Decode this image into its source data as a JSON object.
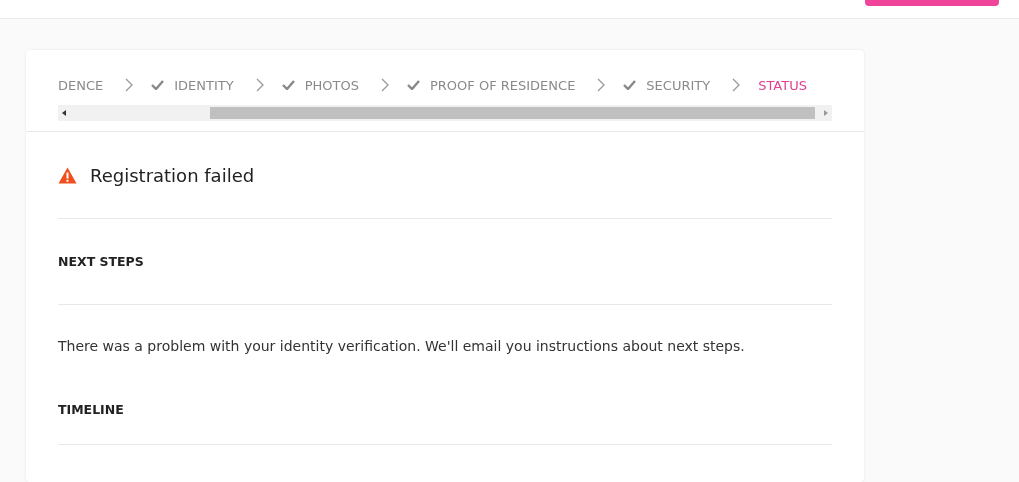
{
  "steps": [
    {
      "label": "DENCE",
      "completed": false,
      "selected": false
    },
    {
      "label": "IDENTITY",
      "completed": true,
      "selected": false
    },
    {
      "label": "PHOTOS",
      "completed": true,
      "selected": false
    },
    {
      "label": "PROOF OF RESIDENCE",
      "completed": true,
      "selected": false
    },
    {
      "label": "SECURITY",
      "completed": true,
      "selected": false
    },
    {
      "label": "STATUS",
      "completed": false,
      "selected": true
    }
  ],
  "status": {
    "title": "Registration failed"
  },
  "sections": [
    {
      "heading": "NEXT STEPS",
      "text": "There was a problem with your identity verification. We'll email you instructions about next steps."
    },
    {
      "heading": "TIMELINE"
    }
  ]
}
